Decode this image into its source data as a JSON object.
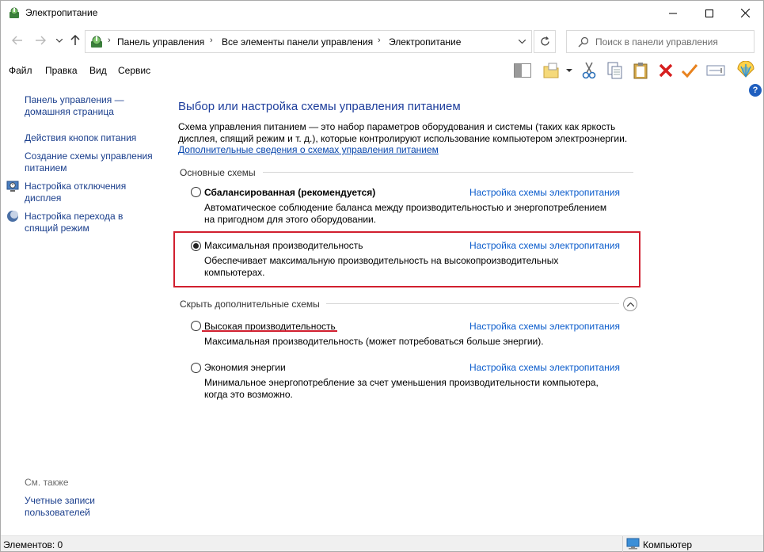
{
  "window": {
    "title": "Электропитание",
    "minimize": "—",
    "maximize": "☐",
    "close": "✕"
  },
  "address": {
    "breadcrumbs": [
      "Панель управления",
      "Все элементы панели управления",
      "Электропитание"
    ],
    "separator": "›",
    "search_placeholder": "Поиск в панели управления"
  },
  "menu": {
    "items": [
      "Файл",
      "Правка",
      "Вид",
      "Сервис"
    ]
  },
  "sidebar": {
    "home": "Панель управления — домашняя страница",
    "items": [
      "Действия кнопок питания",
      "Создание схемы управления питанием",
      "Настройка отключения дисплея",
      "Настройка перехода в спящий режим"
    ],
    "see_also": "См. также",
    "user_accounts": "Учетные записи пользователей"
  },
  "main": {
    "title": "Выбор или настройка схемы управления питанием",
    "description": "Схема управления питанием — это набор параметров оборудования и системы (таких как яркость дисплея, спящий режим и т. д.), которые контролируют использование компьютером электроэнергии.",
    "more_link": "Дополнительные сведения о схемах управления питанием",
    "group_main": "Основные схемы",
    "group_hidden": "Скрыть дополнительные схемы",
    "configure_link": "Настройка схемы электропитания",
    "plans": [
      {
        "name": "Сбалансированная (рекомендуется)",
        "desc": "Автоматическое соблюдение баланса между производительностью и энергопотреблением на пригодном для этого оборудовании.",
        "checked": false
      },
      {
        "name": "Максимальная производительность",
        "desc": "Обеспечивает максимальную производительность на высокопроизводительных компьютерах.",
        "checked": true
      },
      {
        "name": "Высокая производительность",
        "desc": "Максимальная производительность (может потребоваться больше энергии).",
        "checked": false
      },
      {
        "name": "Экономия энергии",
        "desc": "Минимальное энергопотребление за счет уменьшения производительности компьютера, когда это возможно.",
        "checked": false
      }
    ]
  },
  "status": {
    "items_label": "Элементов: 0",
    "computer": "Компьютер"
  },
  "colors": {
    "link": "#0b5ccc",
    "title": "#1e3e9c",
    "highlight": "#d11f2f"
  }
}
